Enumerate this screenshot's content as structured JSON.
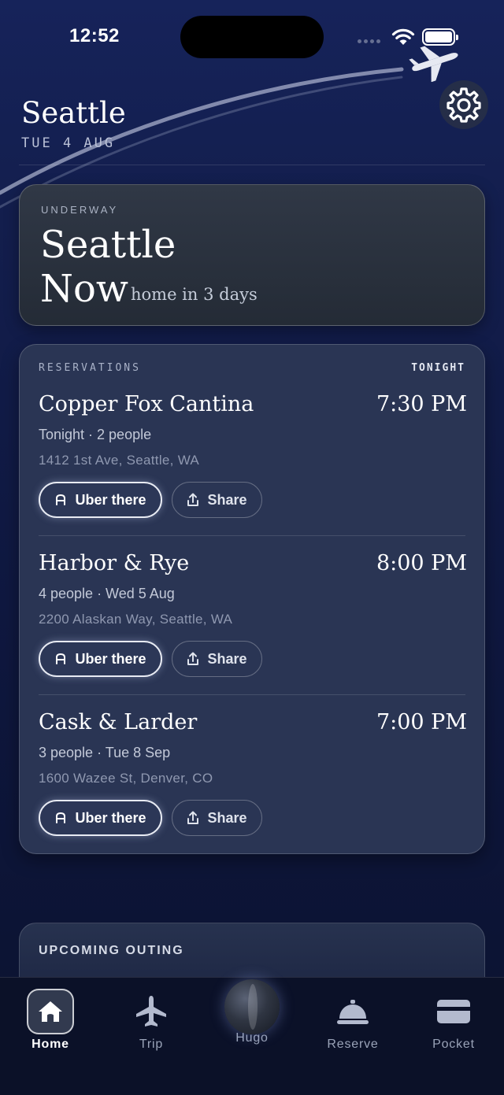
{
  "status_bar": {
    "time": "12:52"
  },
  "header": {
    "city": "Seattle",
    "date": "TUE 4 AUG"
  },
  "underway": {
    "kicker": "UNDERWAY",
    "city": "Seattle",
    "now": "Now",
    "subtitle": "home in 3 days"
  },
  "reservations": {
    "kicker": "RESERVATIONS",
    "badge": "TONIGHT",
    "items": [
      {
        "name": "Copper Fox Cantina",
        "time": "7:30 PM",
        "meta": "Tonight · 2 people",
        "address": "1412 1st Ave, Seattle, WA",
        "uber_label": "Uber there",
        "share_label": "Share"
      },
      {
        "name": "Harbor & Rye",
        "time": "8:00 PM",
        "meta": "4 people · Wed 5 Aug",
        "address": "2200 Alaskan Way, Seattle, WA",
        "uber_label": "Uber there",
        "share_label": "Share"
      },
      {
        "name": "Cask & Larder",
        "time": "7:00 PM",
        "meta": "3 people · Tue 8 Sep",
        "address": "1600 Wazee St, Denver, CO",
        "uber_label": "Uber there",
        "share_label": "Share"
      }
    ]
  },
  "upcoming": {
    "title": "UPCOMING OUTING"
  },
  "tabbar": {
    "tabs": [
      {
        "label": "Home",
        "icon": "home-icon",
        "active": true
      },
      {
        "label": "Trip",
        "icon": "airplane-icon"
      },
      {
        "label": "Hugo",
        "icon": "globe-icon"
      },
      {
        "label": "Reserve",
        "icon": "cloche-icon"
      },
      {
        "label": "Pocket",
        "icon": "wallet-icon"
      }
    ]
  },
  "colors": {
    "background": "#131e4d",
    "card": "#2a3554",
    "underway_card": "#2b323e",
    "muted_text": "#8f98b0"
  }
}
